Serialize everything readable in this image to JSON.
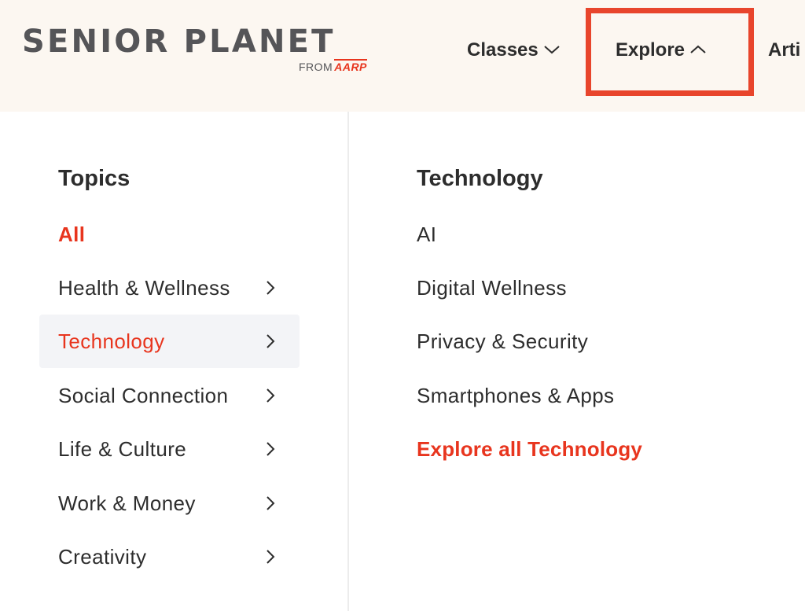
{
  "header": {
    "logo": {
      "main": "SENIOR PLANET",
      "from": "FROM",
      "brand": "AARP"
    },
    "nav": [
      {
        "label": "Classes",
        "icon": "chevron-down-icon"
      },
      {
        "label": "Explore",
        "icon": "chevron-up-icon"
      },
      {
        "label": "Arti"
      }
    ]
  },
  "colors": {
    "accent": "#e8351e",
    "highlight_box": "#e8452c",
    "header_bg": "#fcf7f1",
    "active_row_bg": "#f3f4f7"
  },
  "topics": {
    "heading": "Topics",
    "items": [
      {
        "label": "All",
        "state": "selected"
      },
      {
        "label": "Health & Wellness",
        "icon": "chevron-right-icon"
      },
      {
        "label": "Technology",
        "icon": "chevron-right-icon",
        "state": "active"
      },
      {
        "label": "Social Connection",
        "icon": "chevron-right-icon"
      },
      {
        "label": "Life & Culture",
        "icon": "chevron-right-icon"
      },
      {
        "label": "Work & Money",
        "icon": "chevron-right-icon"
      },
      {
        "label": "Creativity",
        "icon": "chevron-right-icon"
      }
    ]
  },
  "submenu": {
    "heading": "Technology",
    "items": [
      {
        "label": "AI"
      },
      {
        "label": "Digital Wellness"
      },
      {
        "label": "Privacy & Security"
      },
      {
        "label": "Smartphones & Apps"
      }
    ],
    "explore_all": "Explore all Technology"
  }
}
